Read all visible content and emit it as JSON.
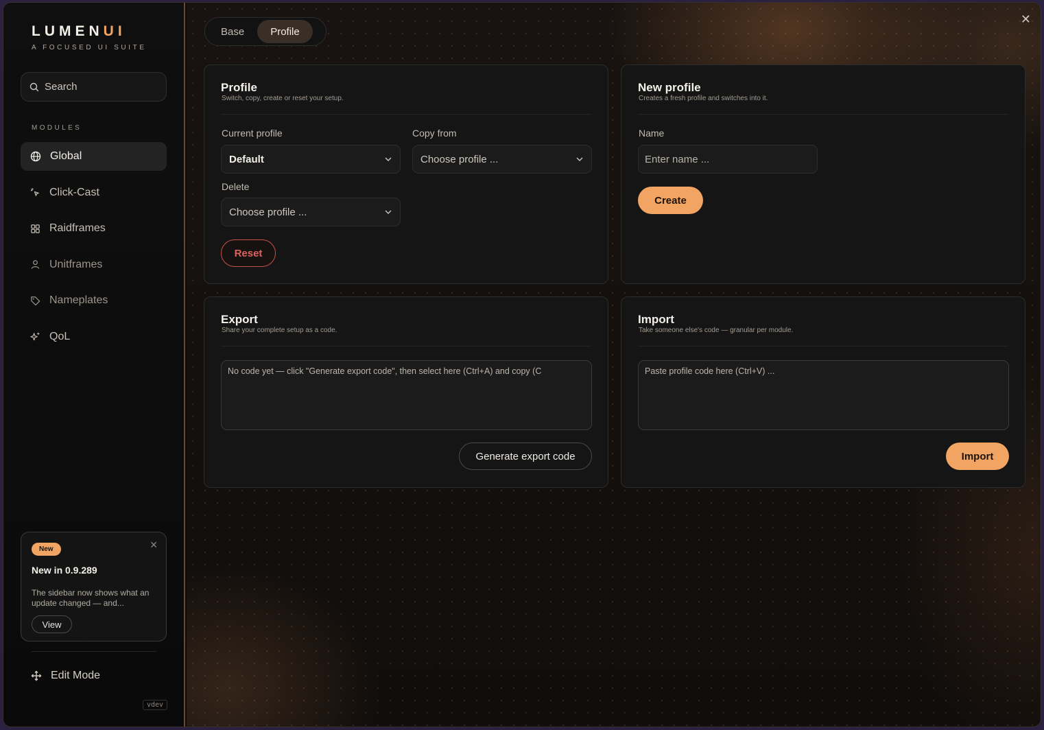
{
  "brand": {
    "name_main": "LUMEN",
    "name_accent": "UI",
    "tagline": "A FOCUSED UI SUITE"
  },
  "sidebar": {
    "search_label": "Search",
    "section_label": "MODULES",
    "items": [
      {
        "label": "Global",
        "icon": "globe-icon",
        "active": true
      },
      {
        "label": "Click-Cast",
        "icon": "sparkle-cursor-icon"
      },
      {
        "label": "Raidframes",
        "icon": "grid-icon"
      },
      {
        "label": "Unitframes",
        "icon": "user-icon"
      },
      {
        "label": "Nameplates",
        "icon": "tag-icon"
      },
      {
        "label": "QoL",
        "icon": "sparkles-icon"
      }
    ],
    "news": {
      "badge": "New",
      "title": "New in 0.9.289",
      "text": "The sidebar now shows what an update changed — and...",
      "view_label": "View"
    },
    "edit_mode_label": "Edit Mode",
    "version": "vdev"
  },
  "tabs": [
    {
      "label": "Base"
    },
    {
      "label": "Profile",
      "active": true
    }
  ],
  "cards": {
    "profile": {
      "title": "Profile",
      "subtitle": "Switch, copy, create or reset your setup.",
      "current_label": "Current profile",
      "current_value": "Default",
      "copy_label": "Copy from",
      "copy_placeholder": "Choose profile ...",
      "delete_label": "Delete",
      "delete_placeholder": "Choose profile ...",
      "reset_label": "Reset"
    },
    "new_profile": {
      "title": "New profile",
      "subtitle": "Creates a fresh profile and switches into it.",
      "name_label": "Name",
      "name_placeholder": "Enter name ...",
      "create_label": "Create"
    },
    "export": {
      "title": "Export",
      "subtitle": "Share your complete setup as a code.",
      "code_placeholder": "No code yet — click \"Generate export code\", then select here (Ctrl+A) and copy (C",
      "generate_label": "Generate export code"
    },
    "import": {
      "title": "Import",
      "subtitle": "Take someone else's code — granular per module.",
      "code_placeholder": "Paste profile code here (Ctrl+V) ...",
      "import_label": "Import"
    }
  },
  "colors": {
    "accent": "#f2a463",
    "danger": "#e0625a",
    "border_accent": "#6a4a30"
  }
}
